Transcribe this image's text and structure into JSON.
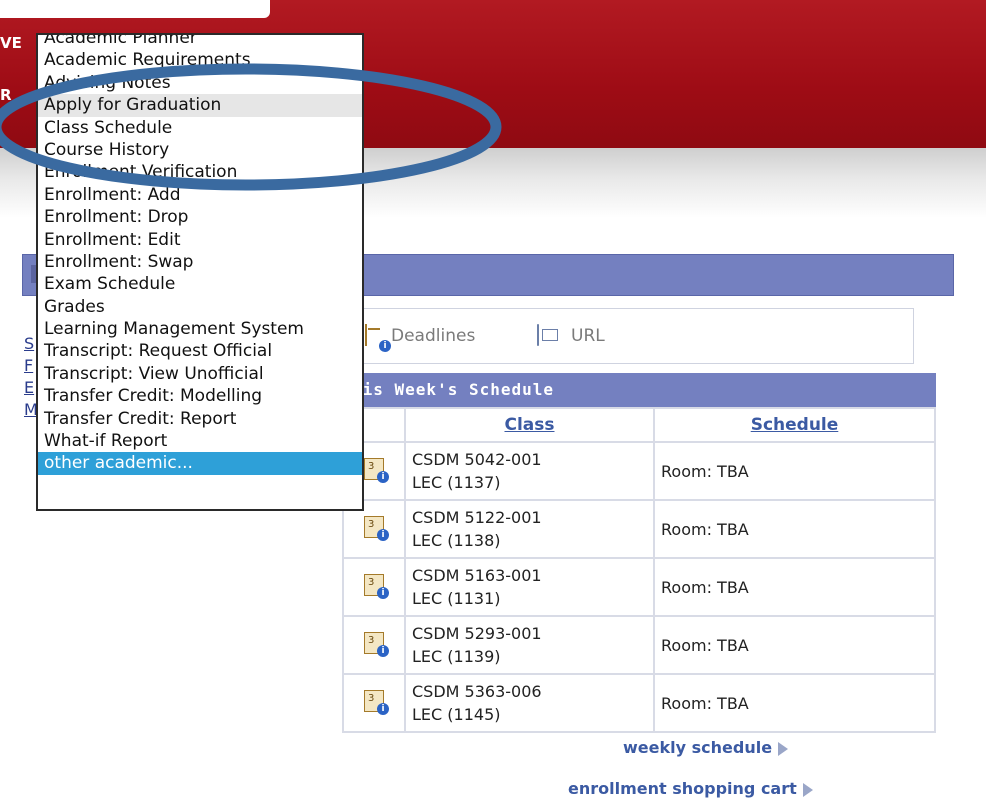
{
  "header": {
    "logo_fragment_1": "VE",
    "logo_fragment_2": "R"
  },
  "toolbar": {
    "deadlines": "Deadlines",
    "url": "URL"
  },
  "left_links": [
    "S",
    "F",
    "E",
    "M"
  ],
  "schedule": {
    "title": "his Week's Schedule",
    "col_class": "Class",
    "col_schedule": "Schedule",
    "rows": [
      {
        "class_line1": "CSDM 5042-001",
        "class_line2": "LEC (1137)",
        "schedule": "Room:  TBA"
      },
      {
        "class_line1": "CSDM 5122-001",
        "class_line2": "LEC (1138)",
        "schedule": "Room:  TBA"
      },
      {
        "class_line1": "CSDM 5163-001",
        "class_line2": "LEC (1131)",
        "schedule": "Room:  TBA"
      },
      {
        "class_line1": "CSDM 5293-001",
        "class_line2": "LEC (1139)",
        "schedule": "Room:  TBA"
      },
      {
        "class_line1": "CSDM 5363-006",
        "class_line2": "LEC (1145)",
        "schedule": "Room:  TBA"
      }
    ]
  },
  "links": {
    "weekly": "weekly schedule",
    "cart": "enrollment shopping cart"
  },
  "menu": {
    "items": [
      "Academic Planner",
      "Academic Requirements",
      "Advising Notes",
      "Apply for Graduation",
      "Class Schedule",
      "Course History",
      "Enrollment Verification",
      "Enrollment: Add",
      "Enrollment: Drop",
      "Enrollment: Edit",
      "Enrollment: Swap",
      "Exam Schedule",
      "Grades",
      "Learning Management System",
      "Transcript: Request Official",
      "Transcript: View Unofficial",
      "Transfer Credit: Modelling",
      "Transfer Credit: Report",
      "What-if Report",
      "other academic..."
    ],
    "highlighted": "Apply for Graduation",
    "selected": "other academic..."
  },
  "colors": {
    "header_red": "#a50c17",
    "pagelet_purple": "#7480c0",
    "selection_blue": "#2ea0d8",
    "annotation_blue": "#3a6aa0"
  }
}
